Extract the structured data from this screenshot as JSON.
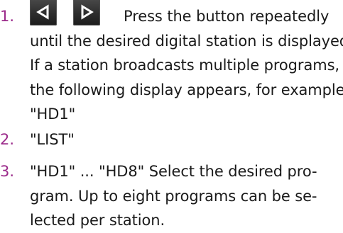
{
  "colors": {
    "step_number": "#9b2a8a",
    "text": "#1a1a1a",
    "button_bg": "#2e2e2e",
    "button_icon": "#ffffff"
  },
  "steps": [
    {
      "number": "1.",
      "icons": [
        "previous-station-icon",
        "next-station-icon"
      ],
      "first_line": "Press the button repeatedly",
      "lines": [
        "until the desired digital station is displayed.",
        "If a station broadcasts multiple programs,",
        "the following display appears, for example:",
        "\"HD1\""
      ]
    },
    {
      "number": "2.",
      "lines": [
        "\"LIST\""
      ]
    },
    {
      "number": "3.",
      "lines": [
        "\"HD1\" ... \"HD8\" Select the desired pro-",
        "gram. Up to eight programs can be se-",
        "lected per station."
      ]
    }
  ]
}
